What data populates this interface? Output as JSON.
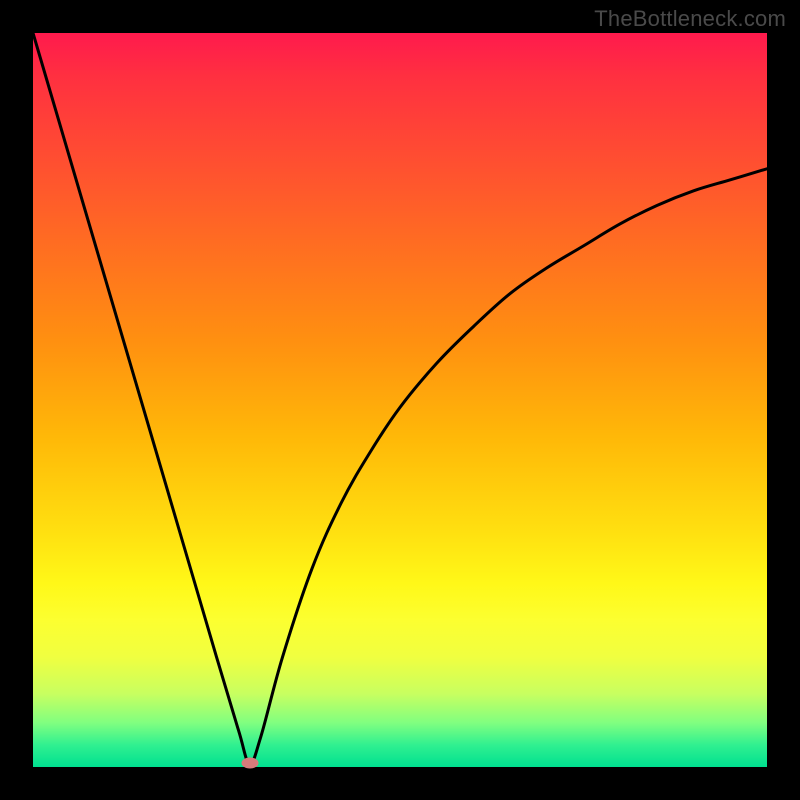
{
  "watermark": "TheBottleneck.com",
  "chart_data": {
    "type": "line",
    "title": "",
    "xlabel": "",
    "ylabel": "",
    "xlim": [
      0,
      100
    ],
    "ylim": [
      0,
      100
    ],
    "series": [
      {
        "name": "curve",
        "x": [
          0,
          5,
          10,
          15,
          20,
          25,
          28,
          29.5,
          31,
          34,
          38,
          42,
          46,
          50,
          55,
          60,
          65,
          70,
          75,
          80,
          85,
          90,
          95,
          100
        ],
        "values": [
          100,
          83,
          66,
          49,
          32,
          15,
          5,
          0.5,
          4,
          15,
          27,
          36,
          43,
          49,
          55,
          60,
          64.5,
          68,
          71,
          74,
          76.5,
          78.5,
          80,
          81.5
        ]
      }
    ],
    "marker": {
      "x": 29.5,
      "y": 0.5,
      "color": "#d77b7b"
    },
    "colors": {
      "curve": "#000000",
      "gradient_top": "#ff1a4d",
      "gradient_bottom": "#00e090",
      "frame": "#000000"
    }
  }
}
